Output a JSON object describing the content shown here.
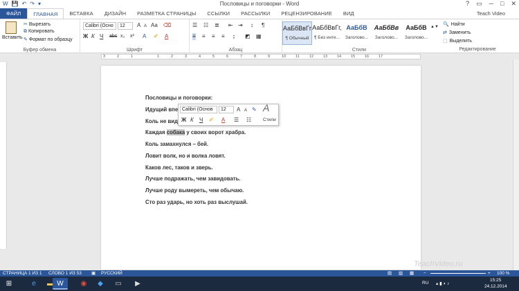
{
  "window": {
    "title": "Пословицы и поговорки - Word",
    "account": "Teach Video",
    "controls": [
      "?",
      "▭",
      "─",
      "□",
      "✕"
    ]
  },
  "qat": [
    "save-icon",
    "undo-icon",
    "redo-icon",
    "customize-icon"
  ],
  "tabs": [
    "ФАЙЛ",
    "ГЛАВНАЯ",
    "ВСТАВКА",
    "ДИЗАЙН",
    "РАЗМЕТКА СТРАНИЦЫ",
    "ССЫЛКИ",
    "РАССЫЛКИ",
    "РЕЦЕНЗИРОВАНИЕ",
    "ВИД"
  ],
  "ribbon": {
    "clipboard": {
      "paste": "Вставить",
      "cut": "Вырезать",
      "copy": "Копировать",
      "format_painter": "Формат по образцу",
      "label": "Буфер обмена"
    },
    "font": {
      "name": "Calibri (Осно",
      "size": "12",
      "label": "Шрифт",
      "bold": "Ж",
      "italic": "К",
      "underline": "Ч",
      "strike": "abc",
      "subscript": "x₂",
      "superscript": "x²",
      "grow": "A",
      "shrink": "A",
      "case": "Aa",
      "font_color": "A"
    },
    "paragraph": {
      "label": "Абзац"
    },
    "styles": {
      "label": "Стили",
      "items": [
        {
          "sample": "АаБбВвГг,",
          "name": "¶ Обычный"
        },
        {
          "sample": "АаБбВвГг,",
          "name": "¶ Без инте..."
        },
        {
          "sample": "АаБбВ",
          "name": "Заголово..."
        },
        {
          "sample": "АаБбВв",
          "name": "Заголово..."
        },
        {
          "sample": "АаБбВ",
          "name": "Заголово..."
        }
      ]
    },
    "editing": {
      "label": "Редактирование",
      "find": "Найти",
      "replace": "Заменить",
      "select": "Выделить"
    }
  },
  "ruler": [
    "3",
    "2",
    "1",
    "1",
    "2",
    "3",
    "4",
    "5",
    "6",
    "7",
    "8",
    "9",
    "10",
    "11",
    "12",
    "13",
    "14",
    "15",
    "16",
    "17"
  ],
  "document": {
    "title": "Пословицы и поговорки:",
    "line1": "Идущий впе",
    "line2": "Коль не вид",
    "line3_pre": "Каждая ",
    "line3_sel": "собака",
    "line3_post": " у своих ворот храбра.",
    "line4": "Коль замахнулся – бей.",
    "line5": "Ловит волк, но и волка ловят.",
    "line6": "Каков лес, таков и зверь.",
    "line7": "Лучше подражать, чем завидовать.",
    "line8": "Лучше роду вымереть, чем обычаю.",
    "line9": "Сто раз ударь, но хоть раз выслушай."
  },
  "mini_toolbar": {
    "font": "Calibri (Основ",
    "size": "12",
    "bold": "Ж",
    "italic": "К",
    "underline": "Ч",
    "styles": "Стили"
  },
  "status": {
    "page": "СТРАНИЦА 1 ИЗ 1",
    "words": "СЛОВО 1 ИЗ 53",
    "language": "РУССКИЙ",
    "zoom": "100 %"
  },
  "watermark": "TeachVideo.ru",
  "taskbar": {
    "lang": "RU",
    "time": "15:25",
    "date": "24.12.2014"
  }
}
